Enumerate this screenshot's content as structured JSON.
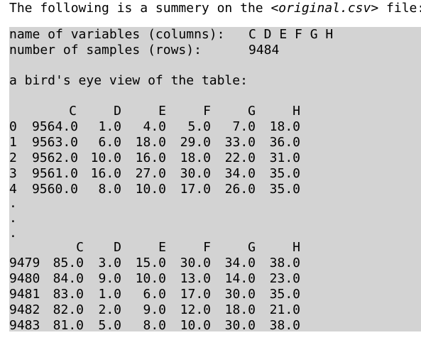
{
  "intro": {
    "prefix": "The following is a summery on the ",
    "filename": "<original.csv>",
    "suffix": " file:"
  },
  "summary": {
    "variables_label": "name of variables (columns):",
    "variables_value": "C D E F G H",
    "samples_label": "number of samples (rows):",
    "samples_value": "9484",
    "birds_eye_label": "a bird's eye view of the table:"
  },
  "table": {
    "columns": [
      "C",
      "D",
      "E",
      "F",
      "G",
      "H"
    ],
    "head_rows": [
      {
        "index": "0",
        "cells": [
          "9564.0",
          "1.0",
          "4.0",
          "5.0",
          "7.0",
          "18.0"
        ]
      },
      {
        "index": "1",
        "cells": [
          "9563.0",
          "6.0",
          "18.0",
          "29.0",
          "33.0",
          "36.0"
        ]
      },
      {
        "index": "2",
        "cells": [
          "9562.0",
          "10.0",
          "16.0",
          "18.0",
          "22.0",
          "31.0"
        ]
      },
      {
        "index": "3",
        "cells": [
          "9561.0",
          "16.0",
          "27.0",
          "30.0",
          "34.0",
          "35.0"
        ]
      },
      {
        "index": "4",
        "cells": [
          "9560.0",
          "8.0",
          "10.0",
          "17.0",
          "26.0",
          "35.0"
        ]
      }
    ],
    "ellipsis": [
      ".",
      ".",
      "."
    ],
    "tail_rows": [
      {
        "index": "9479",
        "cells": [
          "85.0",
          "3.0",
          "15.0",
          "30.0",
          "34.0",
          "38.0"
        ]
      },
      {
        "index": "9480",
        "cells": [
          "84.0",
          "9.0",
          "10.0",
          "13.0",
          "14.0",
          "23.0"
        ]
      },
      {
        "index": "9481",
        "cells": [
          "83.0",
          "1.0",
          "6.0",
          "17.0",
          "30.0",
          "35.0"
        ]
      },
      {
        "index": "9482",
        "cells": [
          "82.0",
          "2.0",
          "9.0",
          "12.0",
          "18.0",
          "21.0"
        ]
      },
      {
        "index": "9483",
        "cells": [
          "81.0",
          "5.0",
          "8.0",
          "10.0",
          "30.0",
          "38.0"
        ]
      }
    ]
  }
}
